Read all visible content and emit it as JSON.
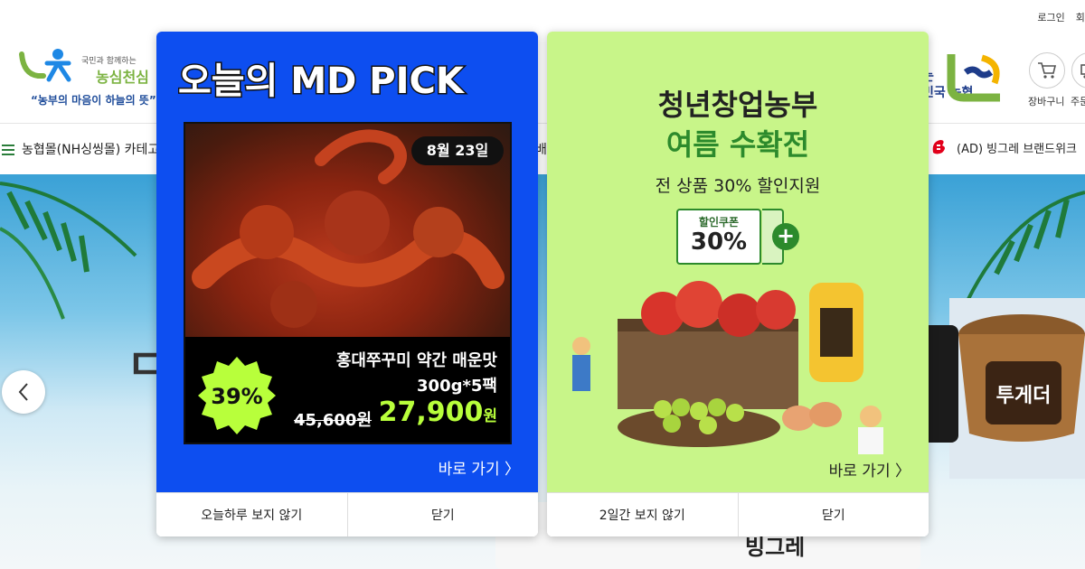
{
  "header": {
    "top_links": [
      "로그인",
      "회원"
    ],
    "logo": {
      "small_text": "국민과 함께하는",
      "name": "농심천심",
      "slogan": "“농부의 마음이 하늘의 뜻”"
    },
    "nh_text_top": "는",
    "nh_text": "민국 농협",
    "icons": [
      {
        "label": "장바구니",
        "icon": "cart-icon"
      },
      {
        "label": "주문",
        "icon": "delivery-icon"
      }
    ]
  },
  "gnb": {
    "category_label": "농협몰(NH싱씽몰) 카테고",
    "mid_fragment": "배",
    "ad_label": "(AD) 빙그레 브랜드위크"
  },
  "banner": {
    "letter": "ㄷ",
    "brand": "빙그레"
  },
  "popups": [
    {
      "title": "오늘의 MD PICK",
      "date": "8월 23일",
      "discount": "39%",
      "product_name": "홍대쭈꾸미 약간 매운맛",
      "product_size": "300g*5팩",
      "price_old": "45,600원",
      "price_new": "27,900",
      "price_unit": "원",
      "go_label": "바로 가기 〉",
      "footer": {
        "hide_label": "오늘하루 보지 않기",
        "close_label": "닫기"
      },
      "colors": {
        "background": "#0d4ef0",
        "accent": "#b8ff3b"
      }
    },
    {
      "title_line1": "청년창업농부",
      "title_line2": "여름 수확전",
      "subtitle": "전 상품 30% 할인지원",
      "coupon_label": "할인쿠폰",
      "coupon_value": "30%",
      "go_label": "바로 가기 〉",
      "footer": {
        "hide_label": "2일간 보지 않기",
        "close_label": "닫기"
      },
      "colors": {
        "background": "#c8f589",
        "accent": "#2c8a2c"
      }
    }
  ]
}
